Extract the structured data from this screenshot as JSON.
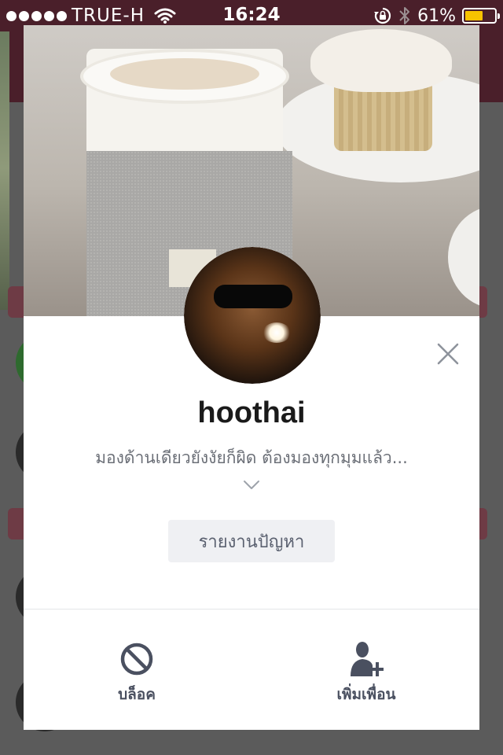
{
  "status_bar": {
    "carrier": "TRUE-H",
    "time": "16:24",
    "battery_percent": "61%",
    "battery_level": 0.61,
    "battery_color": "#f7c200"
  },
  "profile": {
    "display_name": "hoothai",
    "status_message": "มองด้านเดียวยังงัยก็ผิด  ต้องมองทุกมุมแล้ว...",
    "report_label": "รายงานปัญหา"
  },
  "actions": {
    "block_label": "บล็อค",
    "add_friend_label": "เพิ่มเพื่อน"
  },
  "icons": {
    "close": "close-icon",
    "expand": "chevron-down-icon",
    "block": "block-icon",
    "add_friend": "add-friend-icon",
    "wifi": "wifi-icon",
    "rotation_lock": "rotation-lock-icon",
    "bluetooth": "bluetooth-icon"
  },
  "colors": {
    "header_bg": "#4a1f2a",
    "icon_gray": "#4a5060",
    "text_gray": "#6b6f77"
  }
}
